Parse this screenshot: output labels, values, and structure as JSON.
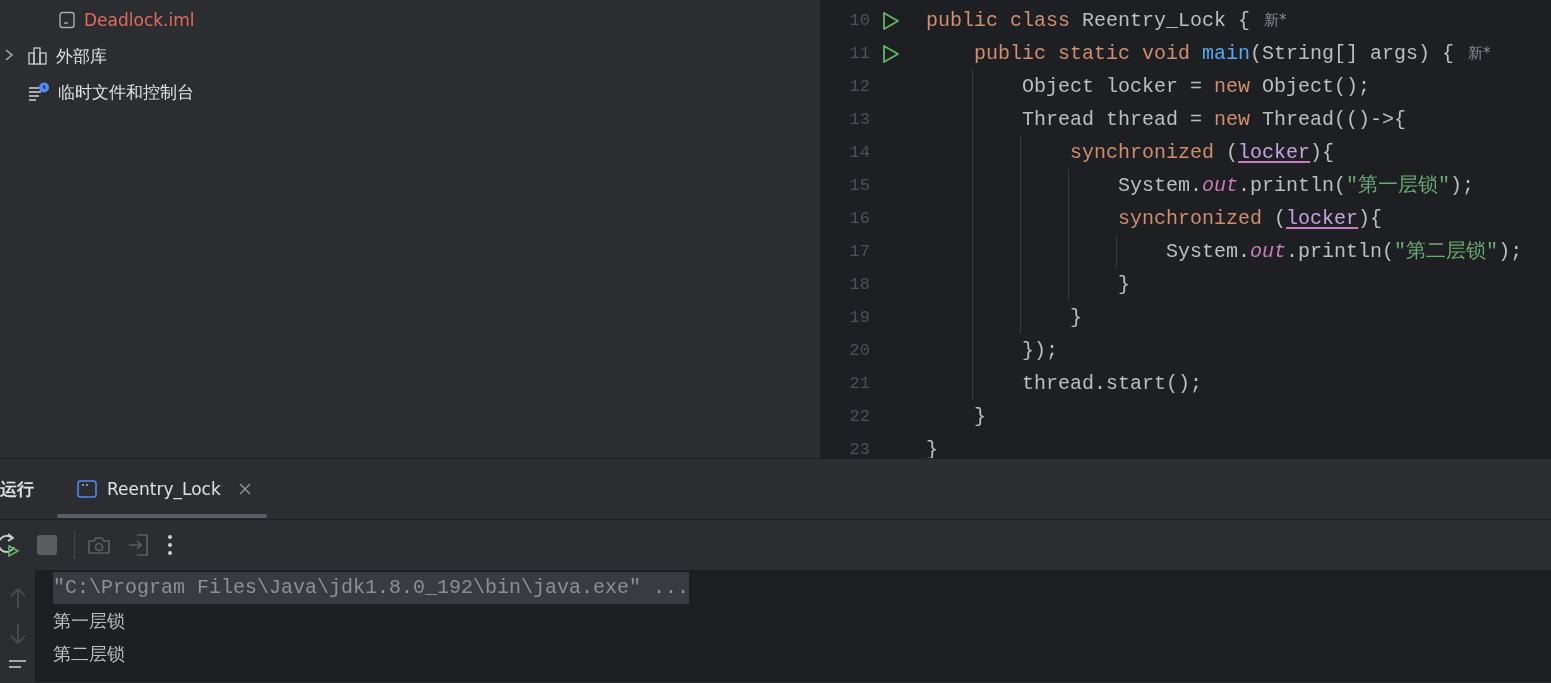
{
  "project_tree": {
    "items": [
      {
        "kind": "file",
        "label": "Deadlock.iml",
        "color": "#e06c5f"
      },
      {
        "kind": "library",
        "label": "外部库",
        "expanded": false,
        "color": "#dfe1e5"
      },
      {
        "kind": "scratches",
        "label": "临时文件和控制台",
        "color": "#dfe1e5"
      }
    ]
  },
  "editor": {
    "lines": [
      {
        "number": "10",
        "runnable": true,
        "tokens": [
          {
            "kind": "keyword",
            "text": "public class"
          },
          {
            "kind": "plain",
            "text": " Reentry_Lock {"
          },
          {
            "kind": "hint",
            "text": "新*"
          }
        ]
      },
      {
        "number": "11",
        "runnable": true,
        "tokens": [
          {
            "kind": "keyword",
            "text": "    public static void"
          },
          {
            "kind": "method",
            "text": " main"
          },
          {
            "kind": "plain",
            "text": "(String[] args) {"
          },
          {
            "kind": "hint",
            "text": "新*"
          }
        ]
      },
      {
        "number": "12",
        "runnable": false,
        "tokens": [
          {
            "kind": "plain",
            "text": "        Object locker = "
          },
          {
            "kind": "keyword",
            "text": "new"
          },
          {
            "kind": "plain",
            "text": " Object();"
          }
        ]
      },
      {
        "number": "13",
        "runnable": false,
        "tokens": [
          {
            "kind": "plain",
            "text": "        Thread thread = "
          },
          {
            "kind": "keyword",
            "text": "new"
          },
          {
            "kind": "plain",
            "text": " Thread(()->{"
          }
        ]
      },
      {
        "number": "14",
        "runnable": false,
        "tokens": [
          {
            "kind": "keyword",
            "text": "            synchronized"
          },
          {
            "kind": "plain",
            "text": " ("
          },
          {
            "kind": "variable",
            "text": "locker"
          },
          {
            "kind": "plain",
            "text": "){"
          }
        ]
      },
      {
        "number": "15",
        "runnable": false,
        "tokens": [
          {
            "kind": "plain",
            "text": "                System."
          },
          {
            "kind": "field",
            "text": "out"
          },
          {
            "kind": "plain",
            "text": ".println("
          },
          {
            "kind": "string",
            "text": "\"第一层锁\""
          },
          {
            "kind": "plain",
            "text": ");"
          }
        ]
      },
      {
        "number": "16",
        "runnable": false,
        "tokens": [
          {
            "kind": "keyword",
            "text": "                synchronized"
          },
          {
            "kind": "plain",
            "text": " ("
          },
          {
            "kind": "variable",
            "text": "locker"
          },
          {
            "kind": "plain",
            "text": "){"
          }
        ]
      },
      {
        "number": "17",
        "runnable": false,
        "tokens": [
          {
            "kind": "plain",
            "text": "                    System."
          },
          {
            "kind": "field",
            "text": "out"
          },
          {
            "kind": "plain",
            "text": ".println("
          },
          {
            "kind": "string",
            "text": "\"第二层锁\""
          },
          {
            "kind": "plain",
            "text": ");"
          }
        ]
      },
      {
        "number": "18",
        "runnable": false,
        "tokens": [
          {
            "kind": "plain",
            "text": "                }"
          }
        ]
      },
      {
        "number": "19",
        "runnable": false,
        "tokens": [
          {
            "kind": "plain",
            "text": "            }"
          }
        ]
      },
      {
        "number": "20",
        "runnable": false,
        "tokens": [
          {
            "kind": "plain",
            "text": "        });"
          }
        ]
      },
      {
        "number": "21",
        "runnable": false,
        "tokens": [
          {
            "kind": "plain",
            "text": "        thread.start();"
          }
        ]
      },
      {
        "number": "22",
        "runnable": false,
        "tokens": [
          {
            "kind": "plain",
            "text": "    }"
          }
        ]
      },
      {
        "number": "23",
        "runnable": false,
        "tokens": [
          {
            "kind": "plain",
            "text": "}"
          }
        ]
      }
    ]
  },
  "run_panel": {
    "title": "运行",
    "tabs": [
      {
        "label": "Reentry_Lock",
        "selected": true
      }
    ],
    "toolbar": [
      {
        "kind": "rerun",
        "disabled": false
      },
      {
        "kind": "stop",
        "disabled": true
      },
      {
        "kind": "camera",
        "disabled": true
      },
      {
        "kind": "exit",
        "disabled": true
      },
      {
        "kind": "more",
        "disabled": false
      }
    ],
    "side_tools": [
      {
        "kind": "up",
        "disabled": true
      },
      {
        "kind": "down",
        "disabled": true
      },
      {
        "kind": "wrap",
        "disabled": false
      }
    ],
    "console": [
      {
        "kind": "command",
        "text": "\"C:\\Program Files\\Java\\jdk1.8.0_192\\bin\\java.exe\" ..."
      },
      {
        "kind": "output",
        "text": "第一层锁"
      },
      {
        "kind": "output",
        "text": "第二层锁"
      }
    ]
  }
}
